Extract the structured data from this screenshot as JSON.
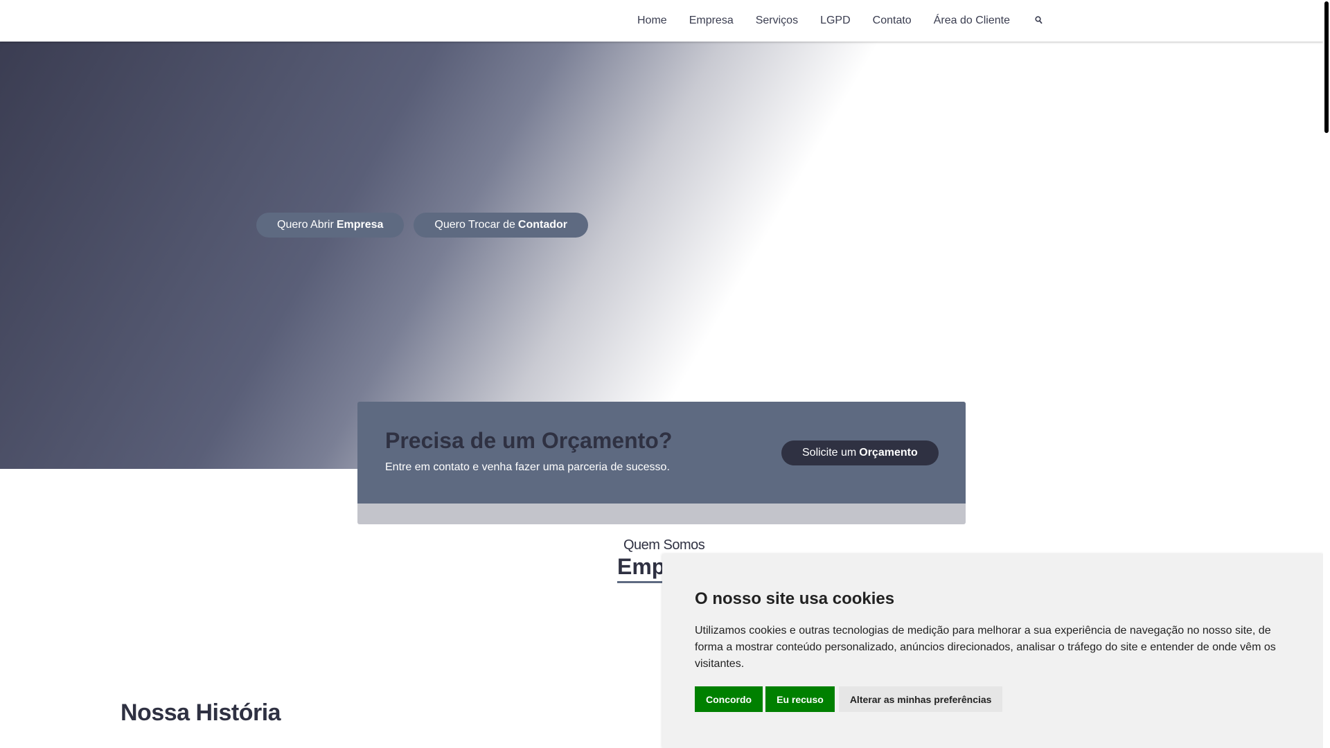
{
  "nav": {
    "items": [
      {
        "label": "Home"
      },
      {
        "label": "Empresa"
      },
      {
        "label": "Serviços"
      },
      {
        "label": "LGPD"
      },
      {
        "label": "Contato"
      },
      {
        "label": "Área do Cliente"
      }
    ],
    "search_icon": "search-icon"
  },
  "hero": {
    "buttons": [
      {
        "prefix": "Quero Abrir",
        "strong": "Empresa"
      },
      {
        "prefix": "Quero Trocar de",
        "strong": "Contador"
      }
    ]
  },
  "quote": {
    "title": "Precisa de um Orçamento?",
    "subtitle": "Entre em contato e venha fazer uma parceria de sucesso.",
    "button_prefix": "Solicite um",
    "button_strong": "Orçamento"
  },
  "about": {
    "eyebrow": "Quem Somos",
    "title": "Emp",
    "history_title": "Nossa História"
  },
  "cookie": {
    "title": "O nosso site usa cookies",
    "text": "Utilizamos cookies e outras tecnologias de medição para melhorar a sua experiência de navegação no nosso site, de forma a mostrar conteúdo personalizado, anúncios direcionados, analisar o tráfego do site e entender de onde vêm os visitantes.",
    "accept": "Concordo",
    "decline": "Eu recuso",
    "preferences": "Alterar as minhas preferências"
  },
  "colors": {
    "primary": "#5e6a81",
    "dark": "#2f3142",
    "cookie_green": "#008000"
  }
}
